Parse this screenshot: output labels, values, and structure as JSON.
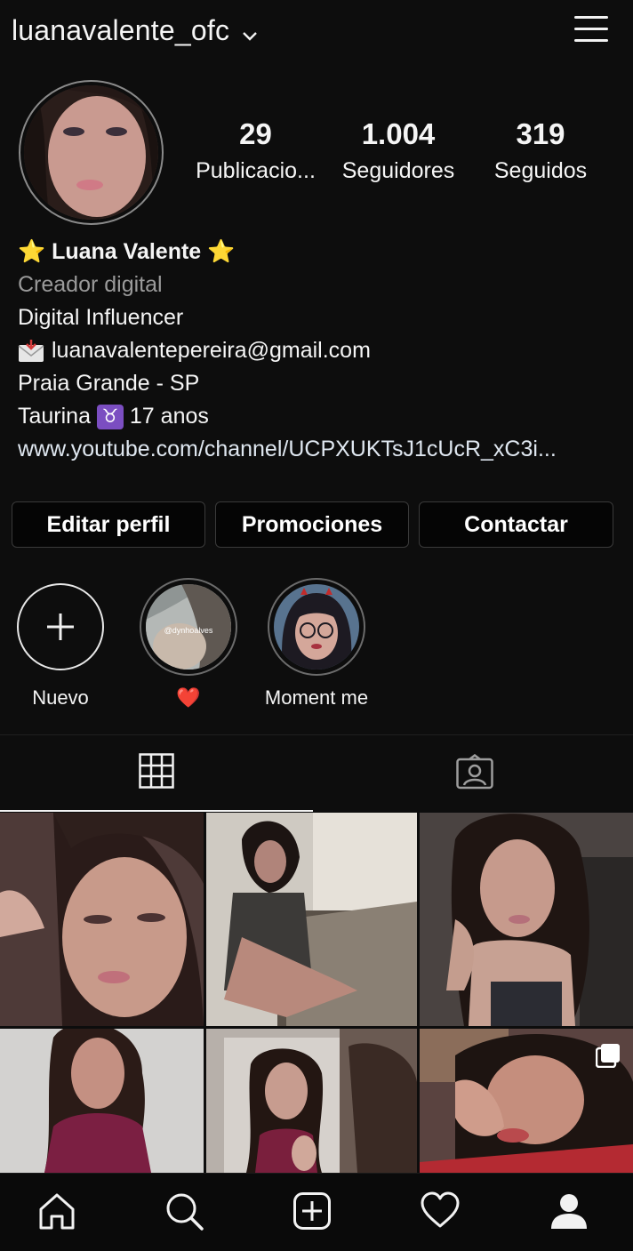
{
  "header": {
    "username": "luanavalente_ofc",
    "chevron_icon": "chevron-down-icon",
    "menu_icon": "hamburger-menu-icon"
  },
  "profile": {
    "avatar_icon": "profile-avatar",
    "stats": [
      {
        "count": "29",
        "label": "Publicacio..."
      },
      {
        "count": "1.004",
        "label": "Seguidores"
      },
      {
        "count": "319",
        "label": "Seguidos"
      }
    ],
    "display_name": "Luana Valente",
    "name_emoji": "⭐",
    "category": "Creador digital",
    "bio": {
      "line1": "Digital Influencer",
      "email": "luanavalentepereira@gmail.com",
      "location": "Praia Grande - SP",
      "zodiac_text": "Taurina",
      "zodiac_symbol": "♉",
      "age_text": "17 anos",
      "link": "www.youtube.com/channel/UCPXUKTsJ1cUcR_xC3i..."
    }
  },
  "buttons": {
    "edit": "Editar perfil",
    "promotions": "Promociones",
    "contact": "Contactar"
  },
  "highlights": [
    {
      "caption": "Nuevo",
      "icon": "plus-icon"
    },
    {
      "caption": "❤️",
      "overlay_text": "@dynhoalves"
    },
    {
      "caption": "Moment me"
    }
  ],
  "tabs": {
    "grid_icon": "grid-icon",
    "tagged_icon": "tagged-icon"
  },
  "posts": [
    {
      "alt": "post-1"
    },
    {
      "alt": "post-2"
    },
    {
      "alt": "post-3"
    },
    {
      "alt": "post-4"
    },
    {
      "alt": "post-5"
    },
    {
      "alt": "post-6",
      "multi_icon": "carousel-icon"
    }
  ],
  "bottom_nav": [
    "home-icon",
    "search-icon",
    "new-post-icon",
    "activity-heart-icon",
    "profile-icon"
  ],
  "colors": {
    "background": "#0d0d0d",
    "text": "#f5f5f5",
    "secondary_text": "#9a9a9a",
    "button_border": "#3a3a3a",
    "zodiac_badge": "#7b4ec1"
  }
}
